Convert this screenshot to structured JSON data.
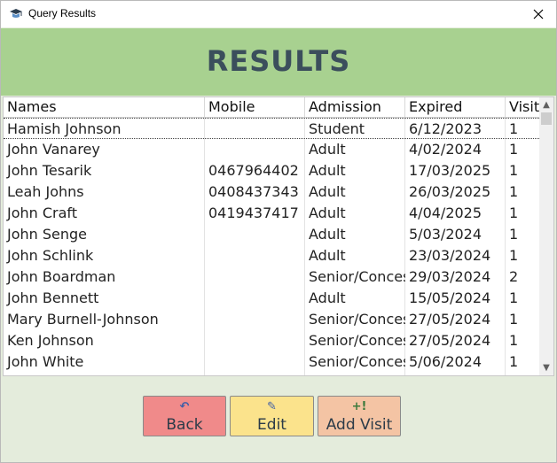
{
  "window": {
    "title": "Query Results",
    "icon": "app-icon",
    "close_label": "✕"
  },
  "banner": {
    "title": "RESULTS"
  },
  "table": {
    "columns": [
      "Names",
      "Mobile",
      "Admission",
      "Expired",
      "Visits"
    ],
    "rows": [
      [
        "Hamish Johnson",
        "",
        "Student",
        "6/12/2023",
        "1"
      ],
      [
        "John Vanarey",
        "",
        "Adult",
        "4/02/2024",
        "1"
      ],
      [
        "John Tesarik",
        "0467964402",
        "Adult",
        "17/03/2025",
        "1"
      ],
      [
        "Leah Johns",
        "0408437343",
        "Adult",
        "26/03/2025",
        "1"
      ],
      [
        "John Craft",
        "0419437417",
        "Adult",
        "4/04/2025",
        "1"
      ],
      [
        "John Senge",
        "",
        "Adult",
        "5/03/2024",
        "1"
      ],
      [
        "John Schlink",
        "",
        "Adult",
        "23/03/2024",
        "1"
      ],
      [
        "John Boardman",
        "",
        "Senior/Concession",
        "29/03/2024",
        "2"
      ],
      [
        "John Bennett",
        "",
        "Adult",
        "15/05/2024",
        "1"
      ],
      [
        "Mary Burnell-Johnson",
        "",
        "Senior/Concession",
        "27/05/2024",
        "1"
      ],
      [
        "Ken Johnson",
        "",
        "Senior/Concession",
        "27/05/2024",
        "1"
      ],
      [
        "John White",
        "",
        "Senior/Concession",
        "5/06/2024",
        "1"
      ]
    ],
    "selected_row": 0
  },
  "buttons": {
    "back": {
      "icon": "↶",
      "label": "Back",
      "color": "#f08a8a"
    },
    "edit": {
      "icon": "✎",
      "label": "Edit",
      "color": "#fbe38c"
    },
    "add_visit": {
      "icon": "+!",
      "label": "Add Visit",
      "color": "#f4c4a4"
    }
  },
  "colors": {
    "banner": "#a8d190",
    "background": "#e4ecdc",
    "title_text": "#3b4e5c"
  }
}
